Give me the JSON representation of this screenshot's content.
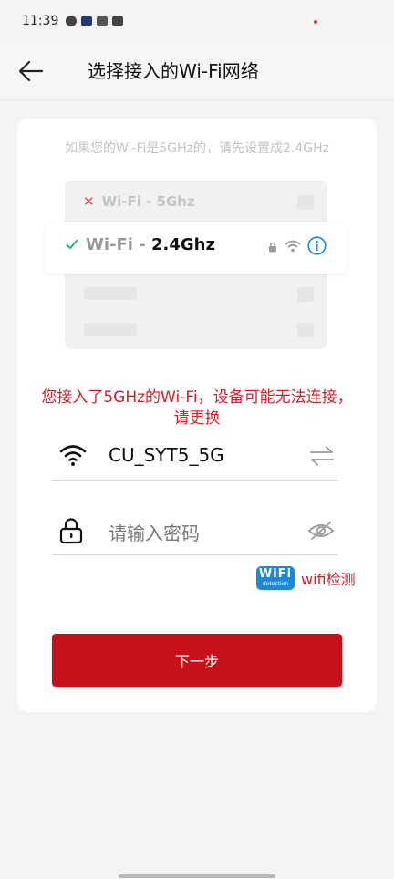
{
  "status_bar": {
    "time": "11:39",
    "icons": [
      "check-circle-icon",
      "play-store-icon",
      "app-icon",
      "message-icon"
    ]
  },
  "header": {
    "back_icon": "arrow-left-icon",
    "title": "选择接入的Wi-Fi网络"
  },
  "card": {
    "hint": "如果您的Wi-Fi是5GHz的，请先设置成2.4GHz",
    "illustration": {
      "row_5g_prefix": "Wi-Fi - ",
      "row_5g_band": "5Ghz",
      "row_24_prefix": "Wi-Fi - ",
      "row_24_band": "2.4Ghz"
    },
    "warning": "您接入了5GHz的Wi-Fi，设备可能无法连接，请更换",
    "ssid_field": {
      "icon": "wifi-icon",
      "value": "CU_SYT5_5G",
      "action_icon": "switch-arrows-icon"
    },
    "password_field": {
      "icon": "lock-icon",
      "placeholder": "请输入密码",
      "action_icon": "eye-hidden-icon"
    },
    "detect": {
      "badge_top": "WiFi",
      "badge_sub": "detection",
      "label": "wifi检测"
    },
    "next_label": "下一步"
  },
  "colors": {
    "accent_red": "#c8101a",
    "warning_red": "#d0202a",
    "info_blue": "#1e88d6",
    "check_green": "#2bb58a"
  }
}
